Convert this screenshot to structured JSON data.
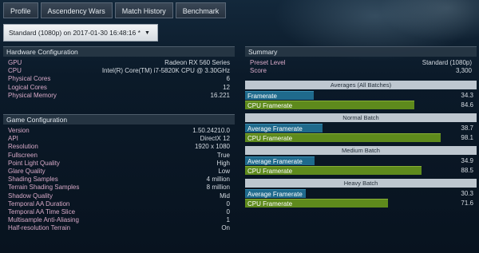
{
  "tabs": [
    {
      "label": "Profile"
    },
    {
      "label": "Ascendency Wars"
    },
    {
      "label": "Match History"
    },
    {
      "label": "Benchmark"
    }
  ],
  "preset_selector": {
    "value": "Standard (1080p) on 2017-01-30 16:48:16 *",
    "arrow": "▼"
  },
  "hardware": {
    "title": "Hardware Configuration",
    "rows": [
      {
        "k": "GPU",
        "v": "Radeon RX 560 Series"
      },
      {
        "k": "CPU",
        "v": "Intel(R) Core(TM) i7-5820K CPU @ 3.30GHz"
      },
      {
        "k": "Physical Cores",
        "v": "6"
      },
      {
        "k": "Logical Cores",
        "v": "12"
      },
      {
        "k": "Physical Memory",
        "v": "16.221"
      }
    ]
  },
  "game": {
    "title": "Game Configuration",
    "rows": [
      {
        "k": "Version",
        "v": "1.50.24210.0"
      },
      {
        "k": "API",
        "v": "DirectX 12"
      },
      {
        "k": "Resolution",
        "v": "1920 x 1080"
      },
      {
        "k": "Fullscreen",
        "v": "True"
      },
      {
        "k": "Point Light Quality",
        "v": "High"
      },
      {
        "k": "Glare Quality",
        "v": "Low"
      },
      {
        "k": "Shading Samples",
        "v": "4 million"
      },
      {
        "k": "Terrain Shading Samples",
        "v": "8 million"
      },
      {
        "k": "Shadow Quality",
        "v": "Mid"
      },
      {
        "k": "Temporal AA Duration",
        "v": "0"
      },
      {
        "k": "Temporal AA Time Slice",
        "v": "0"
      },
      {
        "k": "Multisample Anti-Aliasing",
        "v": "1"
      },
      {
        "k": "Half-resolution Terrain",
        "v": "On"
      }
    ]
  },
  "summary": {
    "title": "Summary",
    "rows": [
      {
        "k": "Preset Level",
        "v": "Standard (1080p)"
      },
      {
        "k": "Score",
        "v": "3,300"
      }
    ]
  },
  "bar_scale_max": 100,
  "batches": [
    {
      "label": "Averages (All Batches)",
      "bars": [
        {
          "name": "Framerate",
          "value": "34.3",
          "kind": "fr"
        },
        {
          "name": "CPU Framerate",
          "value": "84.6",
          "kind": "cpu"
        }
      ]
    },
    {
      "label": "Normal Batch",
      "bars": [
        {
          "name": "Average Framerate",
          "value": "38.7",
          "kind": "fr"
        },
        {
          "name": "CPU Framerate",
          "value": "98.1",
          "kind": "cpu"
        }
      ]
    },
    {
      "label": "Medium Batch",
      "bars": [
        {
          "name": "Average Framerate",
          "value": "34.9",
          "kind": "fr"
        },
        {
          "name": "CPU Framerate",
          "value": "88.5",
          "kind": "cpu"
        }
      ]
    },
    {
      "label": "Heavy Batch",
      "bars": [
        {
          "name": "Average Framerate",
          "value": "30.3",
          "kind": "fr"
        },
        {
          "name": "CPU Framerate",
          "value": "71.6",
          "kind": "cpu"
        }
      ]
    }
  ],
  "colors": {
    "framerate": "#1f6a8c",
    "cpu_framerate": "#5e8a1c"
  }
}
